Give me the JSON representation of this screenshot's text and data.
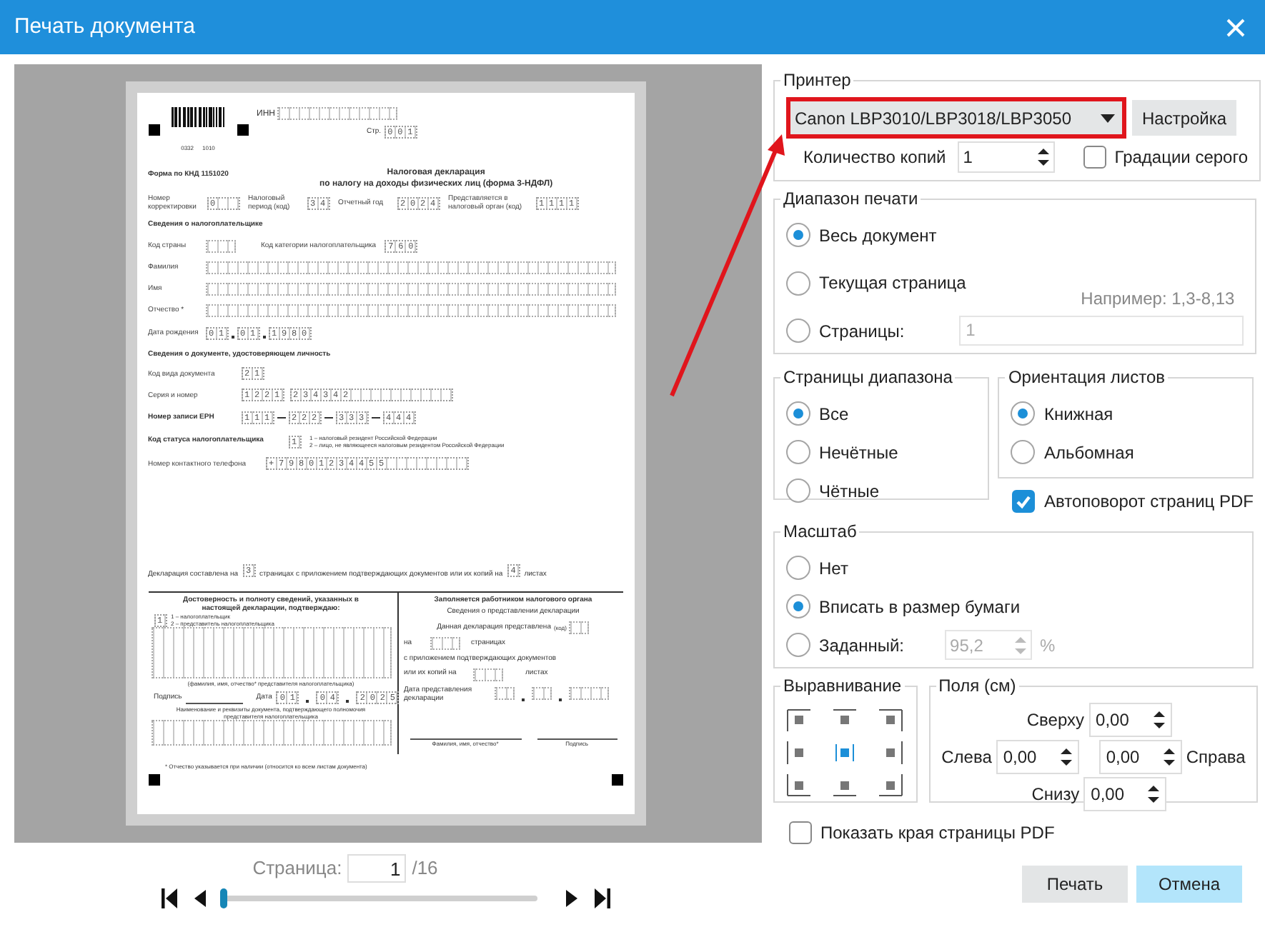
{
  "window": {
    "title": "Печать документа"
  },
  "preview": {
    "document": {
      "barcode_numbers": [
        "0332",
        "1010"
      ],
      "inn_label": "ИНН",
      "page_label": "Стр.",
      "page_number": "001",
      "form_code": "Форма по КНД 1151020",
      "title": "Налоговая декларация",
      "subtitle": "по налогу на доходы физических лиц (форма 3-НДФЛ)",
      "header_fields": [
        {
          "label": "Номер корректировки",
          "value": "0"
        },
        {
          "label": "Налоговый период (код)",
          "value": "34"
        },
        {
          "label": "Отчетный год",
          "value": "2024"
        },
        {
          "label": "Представляется в налоговый орган (код)",
          "value": "1111"
        }
      ],
      "taxpayer_heading": "Сведения о налогоплательщике",
      "country_label": "Код страны",
      "category_label": "Код категории налогоплательщика",
      "category_value": "760",
      "name_fields": [
        "Фамилия",
        "Имя",
        "Отчество *"
      ],
      "birth_label": "Дата рождения",
      "birth_date": [
        "01",
        "01",
        "1980"
      ],
      "id_heading": "Сведения о документе, удостоверяющем личность",
      "doc_type_label": "Код вида документа",
      "doc_type": "21",
      "series_label": "Серия и номер",
      "series": "1221",
      "number": "234342",
      "ern_label": "Номер записи ЕРН",
      "ern": [
        "111",
        "222",
        "333",
        "444"
      ],
      "status_label": "Код статуса налогоплательщика",
      "status": "1",
      "status_notes": [
        "1 – налоговый резидент Российской Федерации",
        "2 – лицо, не являющееся налоговым резидентом Российской Федерации"
      ],
      "phone_label": "Номер контактного телефона",
      "phone": "+79801234455",
      "pages_sentence": [
        {
          "kind": "text",
          "text": "Декларация составлена на"
        },
        {
          "kind": "cell",
          "text": "3"
        },
        {
          "kind": "text",
          "text": "страницах с приложением подтверждающих документов или их копий на"
        },
        {
          "kind": "cell",
          "text": "4"
        },
        {
          "kind": "text",
          "text": "листах"
        }
      ],
      "confirm": {
        "heading": "Достоверность и полноту сведений, указанных в настоящей декларации, подтверждаю:",
        "signer": "1",
        "signer_notes": [
          "1 – налогоплательщик",
          "2 – представитель налогоплательщика"
        ],
        "name_caption": "(фамилия, имя, отчество* представителя налогоплательщика)",
        "signature_label": "Подпись",
        "date_label": "Дата",
        "date": [
          "01",
          "04",
          "2025"
        ],
        "doc_caption": "Наименование и реквизиты документа, подтверждающего полномочия представителя налогоплательщика"
      },
      "office": {
        "heading": "Заполняется работником налогового органа",
        "subheading": "Сведения о представлении декларации",
        "submitted_label": "Данная декларация представлена",
        "code_label": "(код)",
        "on_label": "на",
        "pages_label": "страницах",
        "attachments_label": "с приложением подтверждающих документов",
        "copies_label": "или их копий на",
        "sheets_label": "листах",
        "date_label": "Дата представления декларации",
        "name_caption": "Фамилия, имя, отчество*",
        "signature_caption": "Подпись"
      },
      "footnote": "* Отчество указывается при наличии (относится ко всем листам документа)"
    },
    "page_label": "Страница:",
    "page_value": "1",
    "page_total": "/16",
    "slider": {
      "level": 0
    }
  },
  "printer": {
    "legend": "Принтер",
    "selected": "Canon LBP3010/LBP3018/LBP3050",
    "highlighted": true,
    "setup_button": "Настройка",
    "copies_label": "Количество копий",
    "copies": "1",
    "grayscale": {
      "label": "Градации серого",
      "checked": false
    }
  },
  "print_range": {
    "legend": "Диапазон печати",
    "options": [
      {
        "label": "Весь документ",
        "selected": true
      },
      {
        "label": "Текущая страница",
        "selected": false
      },
      {
        "label": "Страницы:",
        "selected": false
      }
    ],
    "hint": "Например: 1,3-8,13",
    "pages_value": "1"
  },
  "page_subset": {
    "legend": "Страницы диапазона",
    "options": [
      {
        "label": "Все",
        "selected": true
      },
      {
        "label": "Нечётные",
        "selected": false
      },
      {
        "label": "Чётные",
        "selected": false
      }
    ]
  },
  "orientation": {
    "legend": "Ориентация листов",
    "options": [
      {
        "label": "Книжная",
        "selected": true
      },
      {
        "label": "Альбомная",
        "selected": false
      }
    ]
  },
  "auto_rotate": {
    "label": "Автоповорот страниц PDF",
    "checked": true
  },
  "scale": {
    "legend": "Масштаб",
    "options": [
      {
        "label": "Нет",
        "selected": false
      },
      {
        "label": "Вписать в размер бумаги",
        "selected": true
      },
      {
        "label": "Заданный:",
        "selected": false
      }
    ],
    "custom_value": "95,2",
    "unit": "%"
  },
  "alignment": {
    "legend": "Выравнивание",
    "positions": [
      {
        "selected": false
      },
      {
        "selected": false
      },
      {
        "selected": false
      },
      {
        "selected": false
      },
      {
        "selected": true
      },
      {
        "selected": false
      },
      {
        "selected": false
      },
      {
        "selected": false
      },
      {
        "selected": false
      }
    ]
  },
  "margins": {
    "legend": "Поля (см)",
    "top": {
      "label": "Сверху",
      "value": "0,00"
    },
    "left": {
      "label": "Слева",
      "value": "0,00"
    },
    "right": {
      "label": "Справа",
      "value": "0,00"
    },
    "bottom": {
      "label": "Снизу",
      "value": "0,00"
    }
  },
  "show_edges": {
    "label": "Показать края страницы PDF",
    "checked": false
  },
  "buttons": [
    {
      "label": "Печать",
      "kind": "secondary"
    },
    {
      "label": "Отмена",
      "kind": "primary"
    }
  ]
}
